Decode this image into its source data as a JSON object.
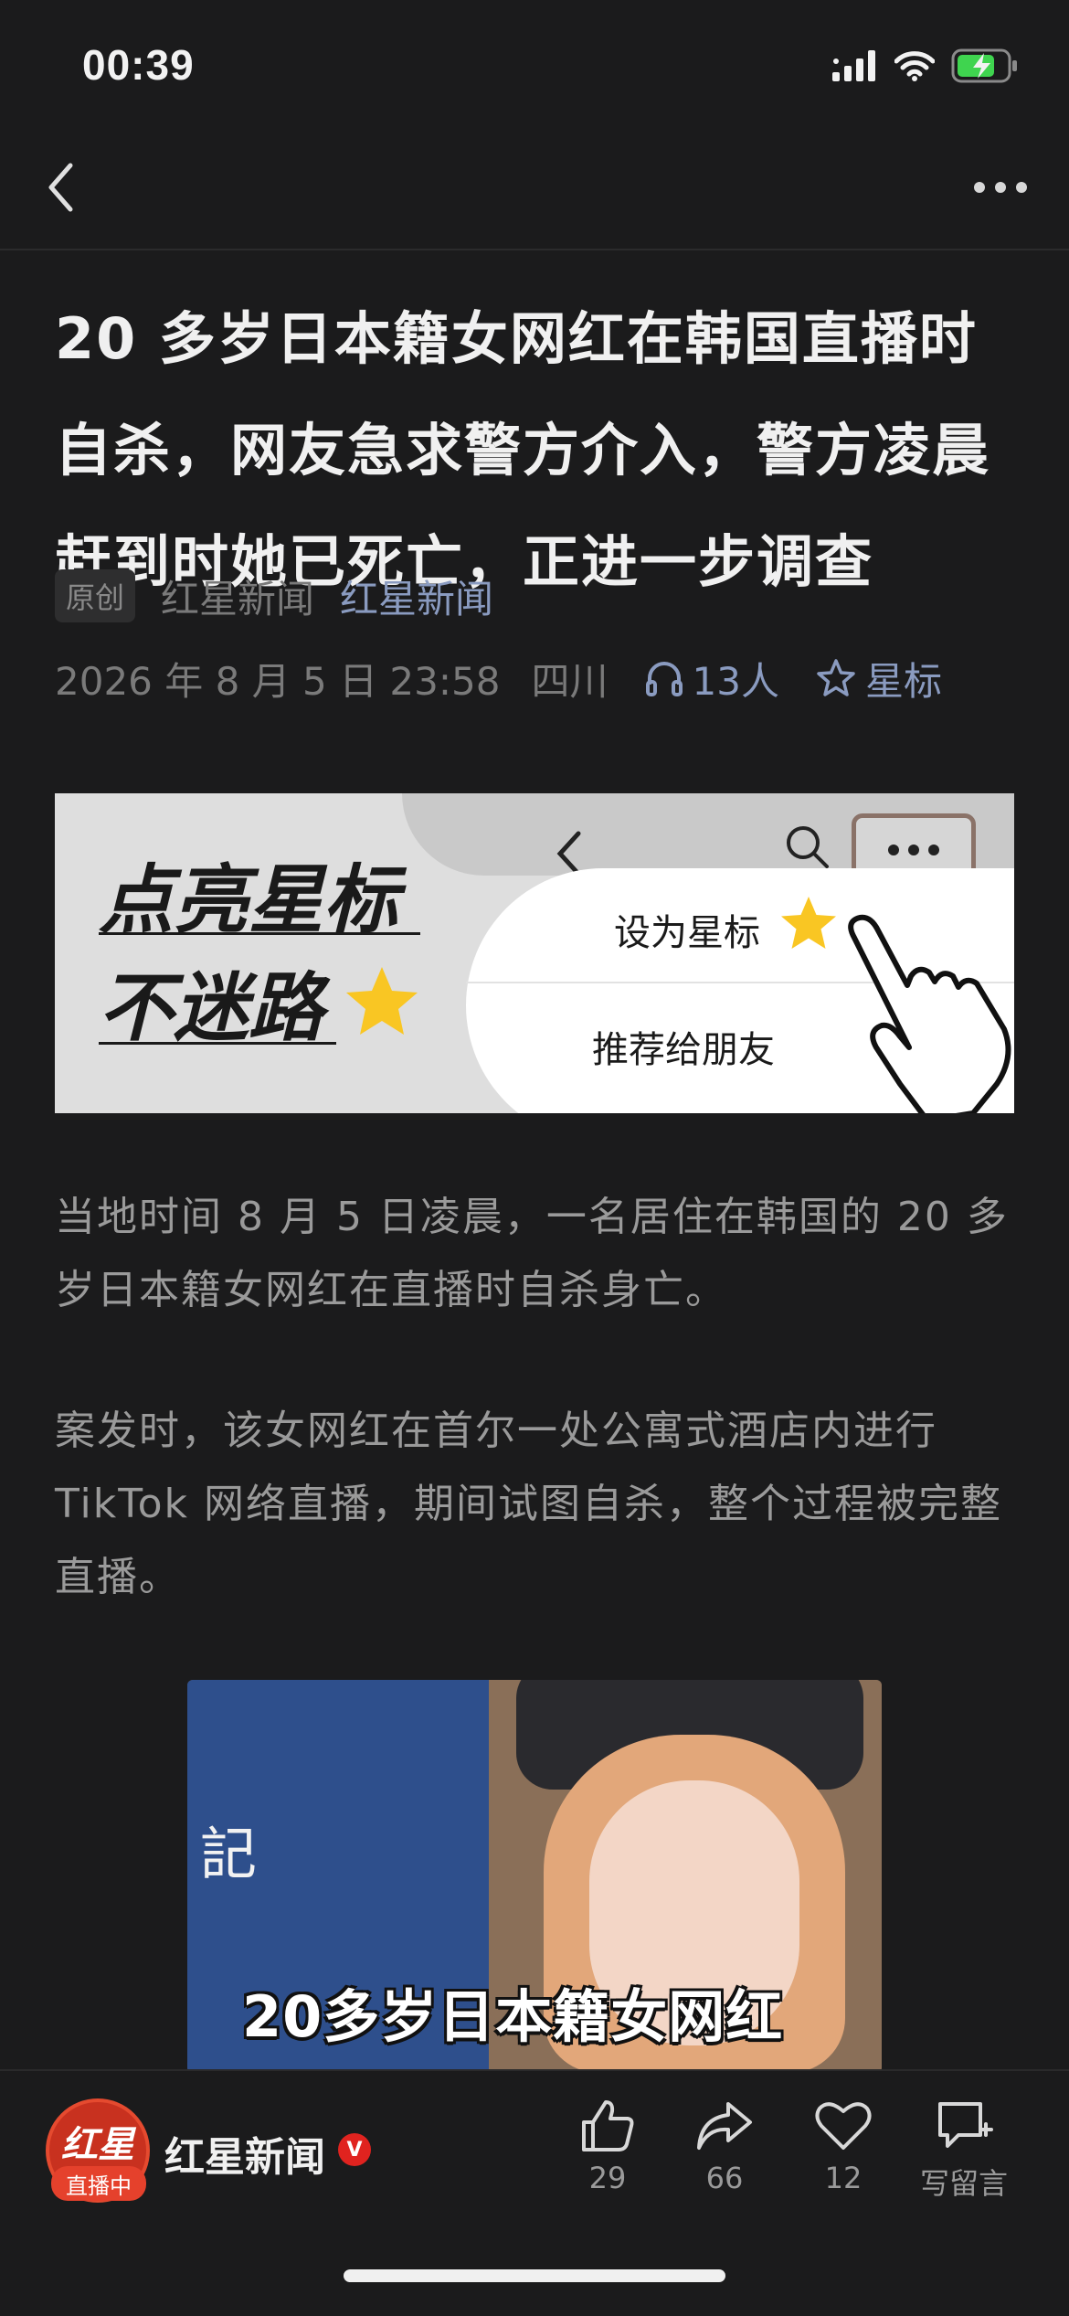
{
  "status": {
    "time": "00:39"
  },
  "article": {
    "title": "20 多岁日本籍女网红在韩国直播时自杀，网友急求警方介入，警方凌晨赶到时她已死亡，正进一步调查",
    "badge": "原创",
    "author": "红星新闻",
    "account": "红星新闻",
    "date": "2026 年 8 月 5 日  23:58",
    "location": "四川",
    "listeners": "13人",
    "star_label": "星标"
  },
  "banner": {
    "line1": "点亮星标",
    "line2": "不迷路",
    "menu_item1": "设为星标",
    "menu_item2": "推荐给朋友"
  },
  "paragraphs": {
    "p1": "当地时间 8 月 5 日凌晨，一名居住在韩国的 20 多岁日本籍女网红在直播时自杀身亡。",
    "p2": "案发时，该女网红在首尔一处公寓式酒店内进行 TikTok 网络直播，期间试图自杀，整个过程被完整直播。"
  },
  "photo": {
    "sign_text": "記",
    "caption": "20多岁日本籍女网红"
  },
  "bottom_bar": {
    "avatar_text": "红星",
    "live_badge": "直播中",
    "name": "红星新闻",
    "verified": "V",
    "like_count": "29",
    "share_count": "66",
    "fav_count": "12",
    "comment_label": "写留言"
  },
  "icons": {
    "accent_blue": "#8a9bc0",
    "battery_green": "#3fd44f",
    "brand_red": "#e0231f"
  }
}
